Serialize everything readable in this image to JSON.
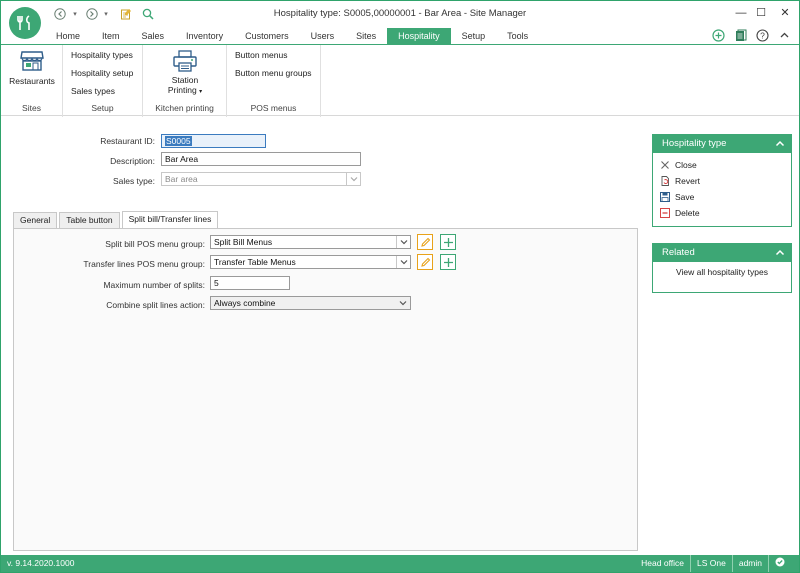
{
  "window": {
    "title": "Hospitality type: S0005,00000001 - Bar Area - Site Manager",
    "minimize": "—",
    "maximize": "☐",
    "close": "✕"
  },
  "ribbon_tabs": [
    {
      "label": "Home"
    },
    {
      "label": "Item"
    },
    {
      "label": "Sales"
    },
    {
      "label": "Inventory"
    },
    {
      "label": "Customers"
    },
    {
      "label": "Users"
    },
    {
      "label": "Sites"
    },
    {
      "label": "Hospitality",
      "active": true
    },
    {
      "label": "Setup"
    },
    {
      "label": "Tools"
    }
  ],
  "ribbon": {
    "sites": {
      "label": "Sites",
      "restaurants": "Restaurants"
    },
    "setup": {
      "label": "Setup",
      "items": [
        "Hospitality types",
        "Hospitality setup",
        "Sales types"
      ]
    },
    "kitchen": {
      "label": "Kitchen printing",
      "station_line1": "Station",
      "station_line2": "Printing"
    },
    "posmenus": {
      "label": "POS menus",
      "items": [
        "Button menus",
        "Button menu groups"
      ]
    }
  },
  "form": {
    "restaurant_id": {
      "label": "Restaurant ID:",
      "value": "S0005"
    },
    "description": {
      "label": "Description:",
      "value": "Bar Area"
    },
    "sales_type": {
      "label": "Sales type:",
      "value": "Bar area"
    }
  },
  "form_tabs": [
    {
      "label": "General"
    },
    {
      "label": "Table button"
    },
    {
      "label": "Split bill/Transfer lines",
      "active": true
    }
  ],
  "split": {
    "split_bill_group": {
      "label": "Split bill POS menu group:",
      "value": "Split Bill Menus"
    },
    "transfer_group": {
      "label": "Transfer lines POS menu group:",
      "value": "Transfer Table Menus"
    },
    "max_splits": {
      "label": "Maximum number of splits:",
      "value": "5"
    },
    "combine_action": {
      "label": "Combine split lines action:",
      "value": "Always combine"
    }
  },
  "panels": {
    "hospitality_type": {
      "title": "Hospitality type",
      "actions": [
        "Close",
        "Revert",
        "Save",
        "Delete"
      ]
    },
    "related": {
      "title": "Related",
      "link": "View all hospitality types"
    }
  },
  "status": {
    "version": "v. 9.14.2020.1000",
    "location": "Head office",
    "product": "LS One",
    "user": "admin"
  },
  "colors": {
    "accent": "#3da775",
    "edit": "#e8a21a",
    "delete": "#d64545"
  }
}
